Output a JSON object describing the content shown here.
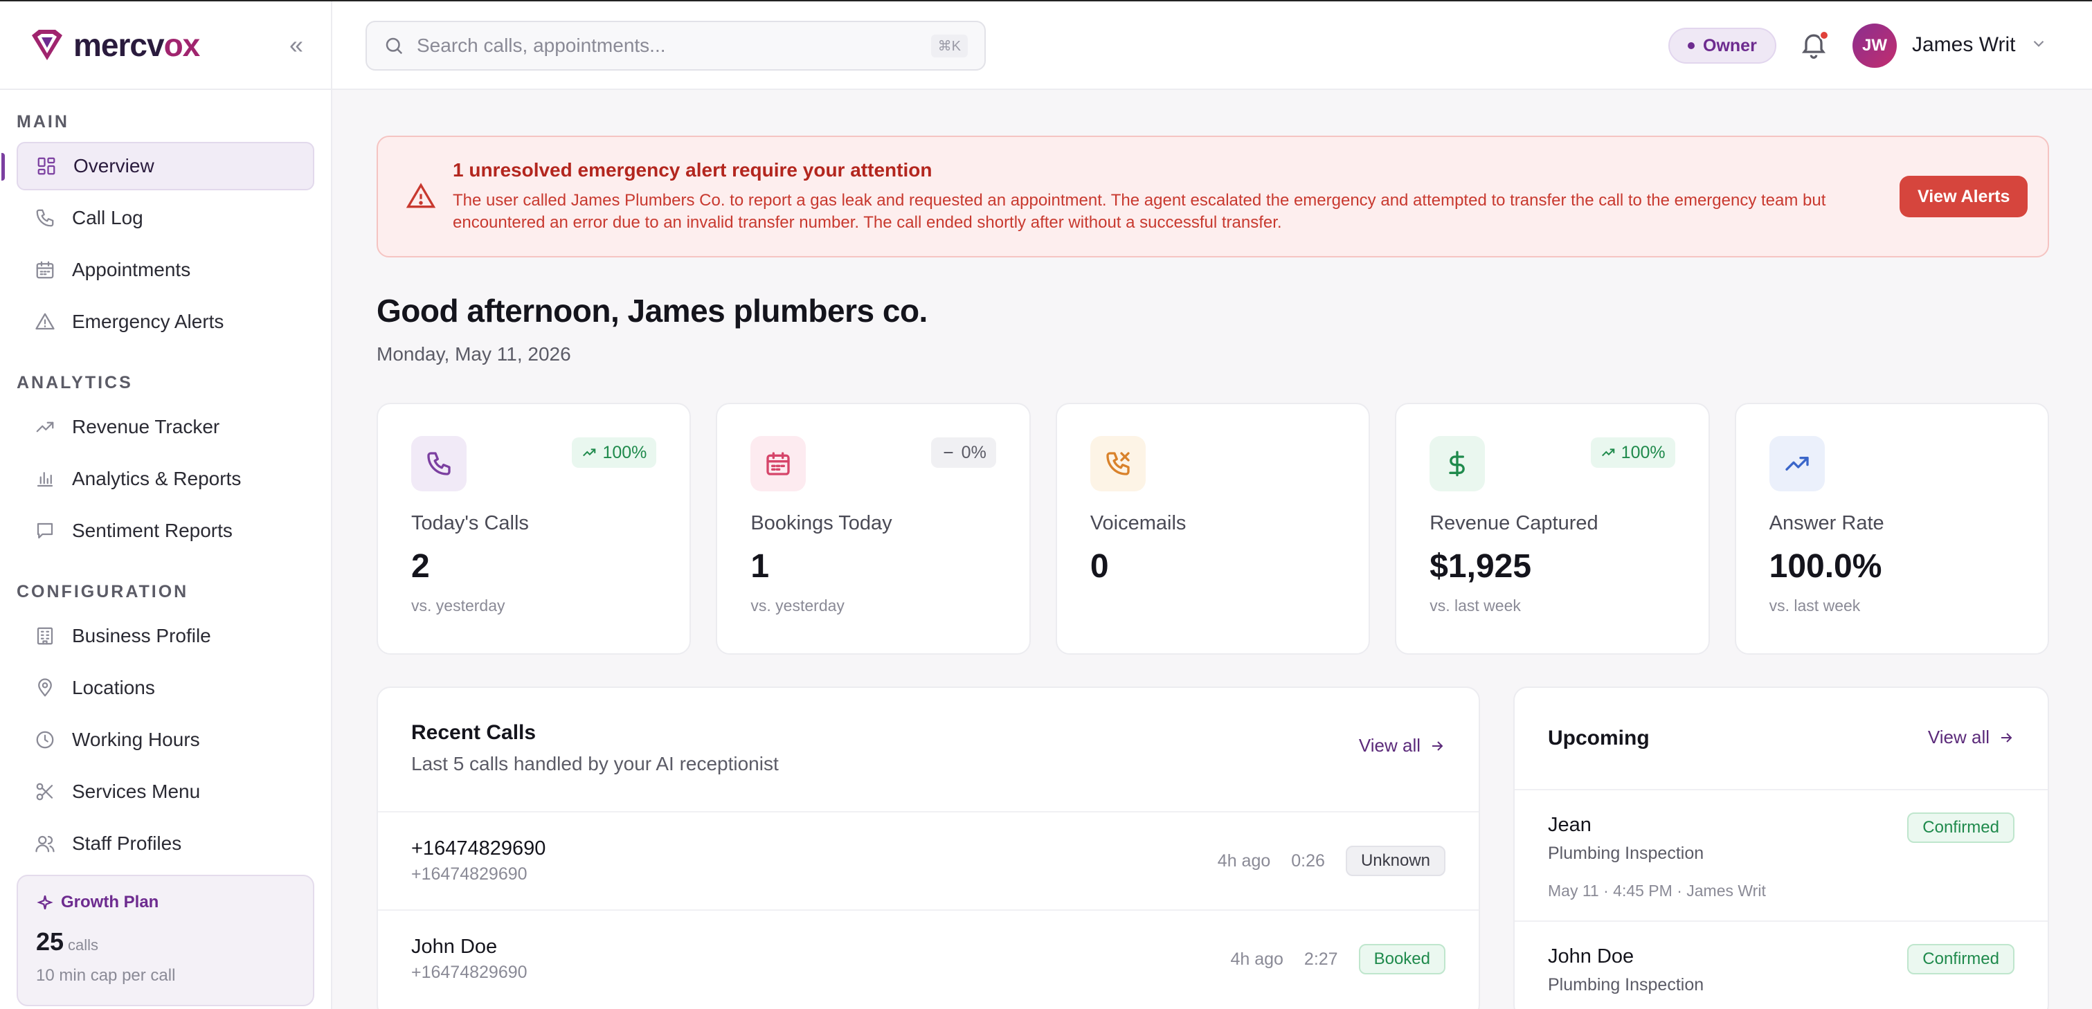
{
  "brand": {
    "name_a": "mercv",
    "name_b": "ox"
  },
  "sidebar": {
    "sections": [
      {
        "heading": "MAIN",
        "items": [
          {
            "label": "Overview",
            "icon": "grid-icon",
            "active": true
          },
          {
            "label": "Call Log",
            "icon": "phone-icon"
          },
          {
            "label": "Appointments",
            "icon": "calendar-icon"
          },
          {
            "label": "Emergency Alerts",
            "icon": "warning-icon"
          }
        ]
      },
      {
        "heading": "ANALYTICS",
        "items": [
          {
            "label": "Revenue Tracker",
            "icon": "trending-up-icon"
          },
          {
            "label": "Analytics & Reports",
            "icon": "bar-chart-icon"
          },
          {
            "label": "Sentiment Reports",
            "icon": "message-icon"
          }
        ]
      },
      {
        "heading": "CONFIGURATION",
        "items": [
          {
            "label": "Business Profile",
            "icon": "building-icon"
          },
          {
            "label": "Locations",
            "icon": "map-pin-icon"
          },
          {
            "label": "Working Hours",
            "icon": "clock-icon"
          },
          {
            "label": "Services Menu",
            "icon": "scissors-icon"
          },
          {
            "label": "Staff Profiles",
            "icon": "users-icon"
          }
        ]
      }
    ],
    "plan": {
      "title": "Growth Plan",
      "count": "25",
      "unit": "calls",
      "note": "10 min cap per call"
    }
  },
  "topbar": {
    "search_placeholder": "Search calls, appointments...",
    "shortcut": "⌘K",
    "role": "Owner",
    "user_initials": "JW",
    "user_name": "James Writ"
  },
  "alert": {
    "title": "1 unresolved emergency alert require your attention",
    "text": "The user called James Plumbers Co. to report a gas leak and requested an appointment. The agent escalated the emergency and attempted to transfer the call to the emergency team but encountered an error due to an invalid transfer number. The call ended shortly after without a successful transfer.",
    "button": "View Alerts"
  },
  "greeting": {
    "title": "Good afternoon, James plumbers co.",
    "date": "Monday, May 11, 2026"
  },
  "stats": [
    {
      "label": "Today's Calls",
      "value": "2",
      "sub": "vs. yesterday",
      "trend": "100%",
      "trend_type": "up",
      "icon": "phone-icon",
      "icon_bg": "#f1eaf7",
      "icon_color": "#7b3fa0"
    },
    {
      "label": "Bookings Today",
      "value": "1",
      "sub": "vs. yesterday",
      "trend": "0%",
      "trend_type": "flat",
      "icon": "calendar-icon",
      "icon_bg": "#fdebf0",
      "icon_color": "#d6456a"
    },
    {
      "label": "Voicemails",
      "value": "0",
      "sub": "",
      "trend": "",
      "trend_type": "none",
      "icon": "phone-missed-icon",
      "icon_bg": "#fdf4e6",
      "icon_color": "#d9822b"
    },
    {
      "label": "Revenue Captured",
      "value": "$1,925",
      "sub": "vs. last week",
      "trend": "100%",
      "trend_type": "up",
      "icon": "dollar-icon",
      "icon_bg": "#eaf7ef",
      "icon_color": "#1f8a4c"
    },
    {
      "label": "Answer Rate",
      "value": "100.0%",
      "sub": "vs. last week",
      "trend": "",
      "trend_type": "none",
      "icon": "trending-up-icon",
      "icon_bg": "#ebf0fb",
      "icon_color": "#3a66c9"
    }
  ],
  "recent_calls": {
    "title": "Recent Calls",
    "subtitle": "Last 5 calls handled by your AI receptionist",
    "view_all": "View all",
    "rows": [
      {
        "name": "+16474829690",
        "phone": "+16474829690",
        "ago": "4h ago",
        "duration": "0:26",
        "status": "Unknown",
        "status_type": "unknown"
      },
      {
        "name": "John Doe",
        "phone": "+16474829690",
        "ago": "4h ago",
        "duration": "2:27",
        "status": "Booked",
        "status_type": "booked"
      }
    ]
  },
  "upcoming": {
    "title": "Upcoming",
    "view_all": "View all",
    "rows": [
      {
        "name": "Jean",
        "service": "Plumbing Inspection",
        "when": "May 11 · 4:45 PM · James Writ",
        "status": "Confirmed"
      },
      {
        "name": "John Doe",
        "service": "Plumbing Inspection",
        "when": "",
        "status": "Confirmed"
      }
    ]
  }
}
